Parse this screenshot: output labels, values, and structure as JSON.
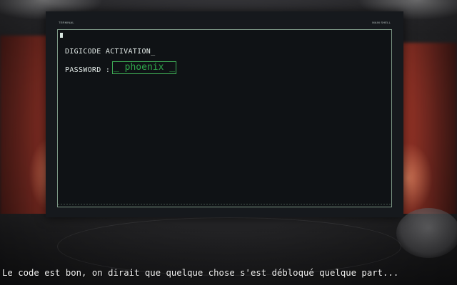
{
  "terminal": {
    "title": "TERMINAL",
    "shell_label": "MAIN SHELL",
    "line1": "DIGICODE ACTIVATION_",
    "password_label": "PASSWORD :",
    "password_value": "_ phoenix _"
  },
  "subtitle": "Le code est bon, on dirait que quelque chose s'est débloqué quelque part...",
  "colors": {
    "terminal_text": "#e3ebe8",
    "input_green": "#2fa64a",
    "screen_border": "#7f9a88"
  }
}
